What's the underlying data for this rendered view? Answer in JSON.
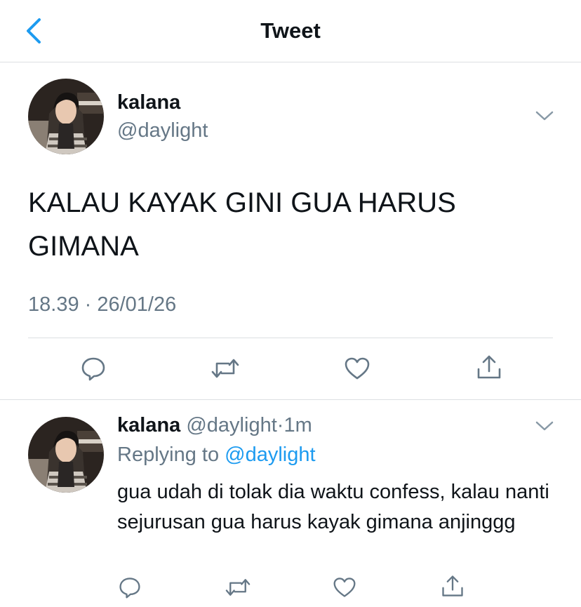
{
  "header": {
    "title": "Tweet"
  },
  "tweet": {
    "display_name": "kalana",
    "handle": "@daylight",
    "text": "KALAU KAYAK GINI GUA HARUS GIMANA",
    "timestamp": "18.39 · 26/01/26"
  },
  "reply": {
    "display_name": "kalana",
    "handle": "@daylight",
    "separator": "·",
    "time": "1m",
    "replying_prefix": "Replying to",
    "replying_handle": "@daylight",
    "text": "gua udah di tolak dia waktu confess, kalau nanti sejurusan gua harus kayak gimana anjinggg"
  },
  "colors": {
    "accent": "#1d9bf0",
    "muted": "#657786",
    "text": "#0f1419",
    "divider": "#dcdfe2"
  },
  "icons": [
    "back-chevron-icon",
    "caret-down-icon",
    "reply-icon",
    "retweet-icon",
    "like-icon",
    "share-icon"
  ]
}
